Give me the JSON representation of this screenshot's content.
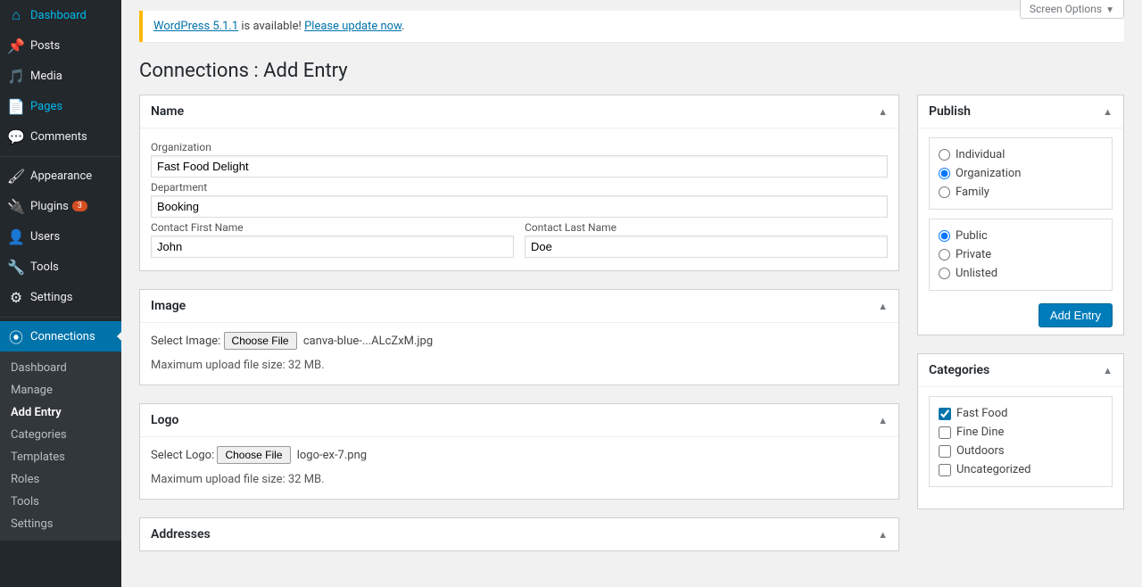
{
  "screen_options": "Screen Options",
  "notice": {
    "prefix": "WordPress 5.1.1",
    "mid": " is available! ",
    "link": "Please update now"
  },
  "page_title": "Connections : Add Entry",
  "sidebar": {
    "items": [
      {
        "icon": "⌂",
        "label": "Dashboard"
      },
      {
        "icon": "📌",
        "label": "Posts"
      },
      {
        "icon": "🎵",
        "label": "Media"
      },
      {
        "icon": "📄",
        "label": "Pages",
        "highlight": true
      },
      {
        "icon": "💬",
        "label": "Comments"
      }
    ],
    "items2": [
      {
        "icon": "🖌",
        "label": "Appearance"
      },
      {
        "icon": "🔌",
        "label": "Plugins",
        "badge": "3"
      },
      {
        "icon": "👤",
        "label": "Users"
      },
      {
        "icon": "🔧",
        "label": "Tools"
      },
      {
        "icon": "⚙",
        "label": "Settings"
      }
    ],
    "conn": {
      "icon": "⦿",
      "label": "Connections"
    },
    "sub": [
      "Dashboard",
      "Manage",
      "Add Entry",
      "Categories",
      "Templates",
      "Roles",
      "Tools",
      "Settings"
    ]
  },
  "panels": {
    "name": {
      "title": "Name",
      "org_label": "Organization",
      "org_value": "Fast Food Delight",
      "dept_label": "Department",
      "dept_value": "Booking",
      "first_label": "Contact First Name",
      "first_value": "John",
      "last_label": "Contact Last Name",
      "last_value": "Doe"
    },
    "image": {
      "title": "Image",
      "select": "Select Image:",
      "btn": "Choose File",
      "file": "canva-blue-...ALcZxM.jpg",
      "hint": "Maximum upload file size: 32 MB."
    },
    "logo": {
      "title": "Logo",
      "select": "Select Logo:",
      "btn": "Choose File",
      "file": "logo-ex-7.png",
      "hint": "Maximum upload file size: 32 MB."
    },
    "addresses": {
      "title": "Addresses"
    }
  },
  "publish": {
    "title": "Publish",
    "types": [
      "Individual",
      "Organization",
      "Family"
    ],
    "type_selected": "Organization",
    "vis": [
      "Public",
      "Private",
      "Unlisted"
    ],
    "vis_selected": "Public",
    "button": "Add Entry"
  },
  "categories": {
    "title": "Categories",
    "items": [
      {
        "label": "Fast Food",
        "checked": true
      },
      {
        "label": "Fine Dine",
        "checked": false
      },
      {
        "label": "Outdoors",
        "checked": false
      },
      {
        "label": "Uncategorized",
        "checked": false
      }
    ]
  }
}
